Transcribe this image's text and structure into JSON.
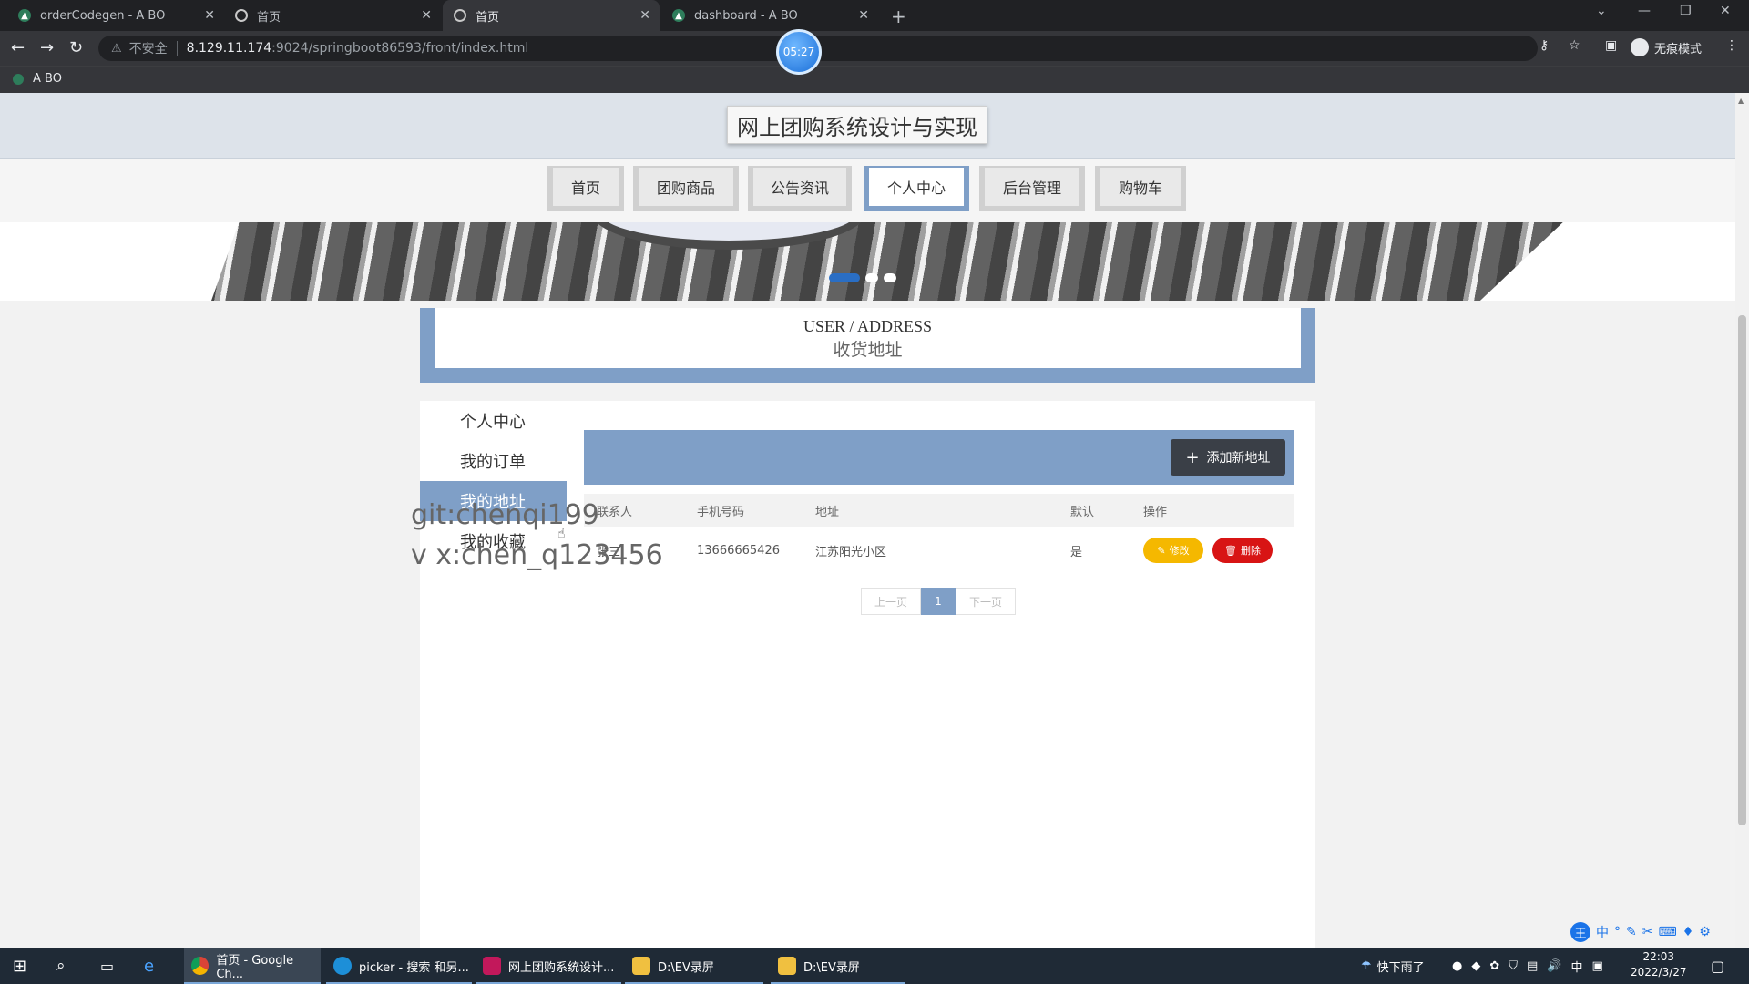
{
  "browser": {
    "tabs": [
      {
        "title": "orderCodegen - A BO"
      },
      {
        "title": "首页"
      },
      {
        "title": "首页"
      },
      {
        "title": "dashboard - A BO"
      }
    ],
    "address": {
      "security": "不安全",
      "host": "8.129.11.174",
      "path": ":9024/springboot86593/front/index.html"
    },
    "profile": "无痕模式",
    "bookmark": "A BO",
    "timer": "05:27"
  },
  "site": {
    "title": "网上团购系统设计与实现",
    "nav": [
      "首页",
      "团购商品",
      "公告资讯",
      "个人中心",
      "后台管理",
      "购物车"
    ],
    "active_nav": "个人中心"
  },
  "section": {
    "en": "USER / ADDRESS",
    "cn": "收货地址"
  },
  "sidebar": {
    "items": [
      {
        "label": "个人中心"
      },
      {
        "label": "我的订单"
      },
      {
        "label": "我的地址"
      },
      {
        "label": "我的收藏"
      }
    ],
    "active": "我的地址"
  },
  "toolbar": {
    "add_label": "添加新地址"
  },
  "table": {
    "headers": [
      "联系人",
      "手机号码",
      "地址",
      "默认",
      "操作"
    ],
    "rows": [
      {
        "contact": "张三",
        "phone": "13666665426",
        "address": "江苏阳光小区",
        "default": "是"
      }
    ],
    "edit_label": "修改",
    "delete_label": "删除"
  },
  "pager": {
    "prev": "上一页",
    "current": "1",
    "next": "下一页"
  },
  "watermark": {
    "line1": "git:chenqi199",
    "line2": "v x:chen_q123456"
  },
  "ime": {
    "logo": "王",
    "mode": "中"
  },
  "taskbar": {
    "apps": [
      {
        "label": "首页 - Google Ch..."
      },
      {
        "label": "picker - 搜索 和另..."
      },
      {
        "label": "网上团购系统设计..."
      },
      {
        "label": "D:\\EV录屏"
      },
      {
        "label": "D:\\EV录屏"
      }
    ],
    "weather": "快下雨了",
    "input": "中",
    "time": "22:03",
    "date": "2022/3/27"
  },
  "colors": {
    "accent": "#7f9fc7",
    "edit": "#f5b800",
    "delete": "#d81414",
    "dark_button": "#3a3f47"
  }
}
